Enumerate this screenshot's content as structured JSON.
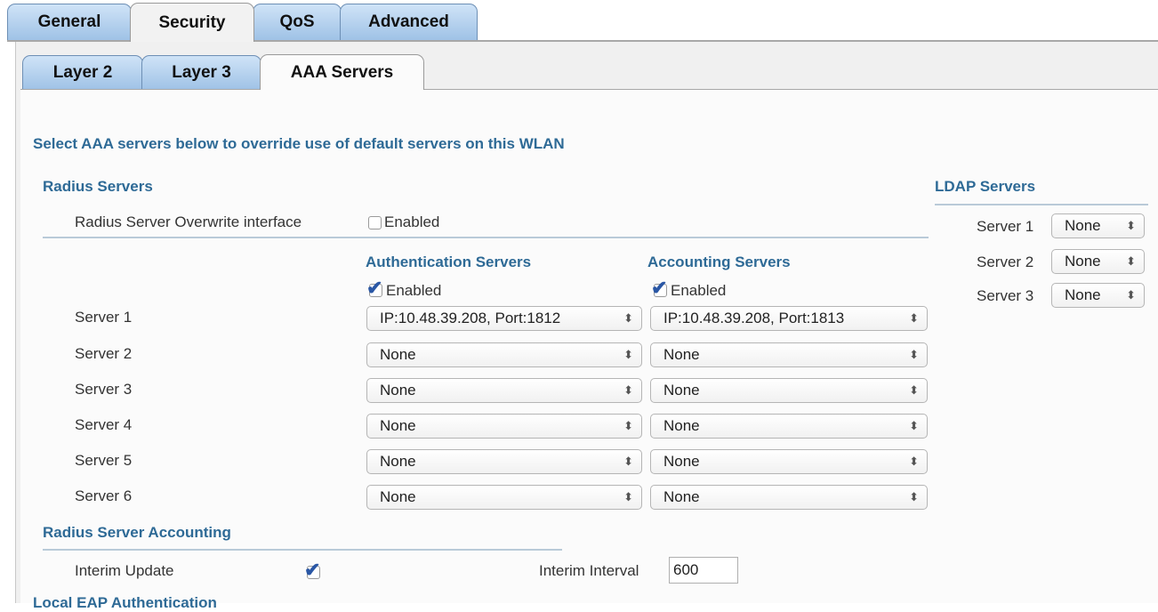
{
  "tabs": [
    {
      "label": "General",
      "active": false
    },
    {
      "label": "Security",
      "active": true
    },
    {
      "label": "QoS",
      "active": false
    },
    {
      "label": "Advanced",
      "active": false
    }
  ],
  "subtabs": [
    {
      "label": "Layer 2",
      "active": false
    },
    {
      "label": "Layer 3",
      "active": false
    },
    {
      "label": "AAA Servers",
      "active": true
    }
  ],
  "intro": "Select AAA servers below to override use of default servers on this WLAN",
  "radius": {
    "heading": "Radius Servers",
    "overwrite_label": "Radius Server Overwrite interface",
    "overwrite_checkbox_label": "Enabled",
    "overwrite_checked": false,
    "auth_heading": "Authentication Servers",
    "acct_heading": "Accounting Servers",
    "auth_enabled_label": "Enabled",
    "auth_enabled": true,
    "acct_enabled_label": "Enabled",
    "acct_enabled": true,
    "servers": [
      {
        "label": "Server 1",
        "auth": "IP:10.48.39.208, Port:1812",
        "acct": "IP:10.48.39.208, Port:1813"
      },
      {
        "label": "Server 2",
        "auth": "None",
        "acct": "None"
      },
      {
        "label": "Server 3",
        "auth": "None",
        "acct": "None"
      },
      {
        "label": "Server 4",
        "auth": "None",
        "acct": "None"
      },
      {
        "label": "Server 5",
        "auth": "None",
        "acct": "None"
      },
      {
        "label": "Server 6",
        "auth": "None",
        "acct": "None"
      }
    ]
  },
  "ldap": {
    "heading": "LDAP Servers",
    "servers": [
      {
        "label": "Server 1",
        "value": "None"
      },
      {
        "label": "Server 2",
        "value": "None"
      },
      {
        "label": "Server 3",
        "value": "None"
      }
    ]
  },
  "accounting": {
    "heading": "Radius Server Accounting",
    "interim_update_label": "Interim Update",
    "interim_update_checked": true,
    "interim_interval_label": "Interim Interval",
    "interim_interval_value": "600"
  },
  "cut_off_heading": "Local EAP Authentication",
  "icons": {
    "select_arrow": "updown-arrows-icon",
    "check": "checkmark-icon"
  },
  "colors": {
    "heading": "#2e6a96",
    "tab": "#9fc2e6",
    "check": "#2a57a5"
  }
}
